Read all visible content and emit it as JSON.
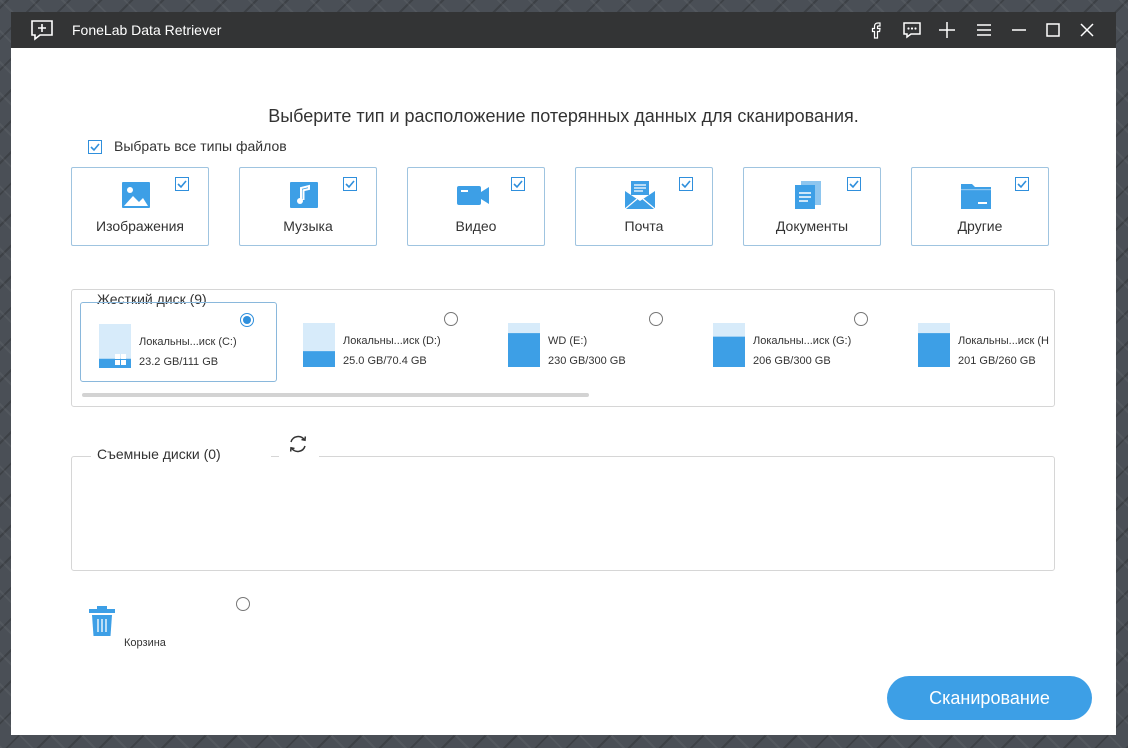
{
  "app": {
    "title": "FoneLab Data Retriever"
  },
  "titlebar": {
    "buttons": [
      "facebook-icon",
      "feedback-icon",
      "plus-icon",
      "menu-icon",
      "minimize-icon",
      "maximize-icon",
      "close-icon"
    ]
  },
  "heading": "Выберите тип и расположение потерянных данных для сканирования.",
  "select_all": {
    "label": "Выбрать все типы файлов",
    "checked": true
  },
  "file_types": [
    {
      "label": "Изображения",
      "icon": "image-icon",
      "checked": true
    },
    {
      "label": "Музыка",
      "icon": "music-icon",
      "checked": true
    },
    {
      "label": "Видео",
      "icon": "video-icon",
      "checked": true
    },
    {
      "label": "Почта",
      "icon": "mail-icon",
      "checked": true
    },
    {
      "label": "Документы",
      "icon": "document-icon",
      "checked": true
    },
    {
      "label": "Другие",
      "icon": "folder-icon",
      "checked": true
    }
  ],
  "hard_disk": {
    "title": "Жесткий диск (9)",
    "drives": [
      {
        "name": "Локальны...иск (C:)",
        "size": "23.2 GB/111 GB",
        "used_fraction": 0.21,
        "selected": true,
        "system": true
      },
      {
        "name": "Локальны...иск (D:)",
        "size": "25.0 GB/70.4 GB",
        "used_fraction": 0.36,
        "selected": false,
        "system": false
      },
      {
        "name": "WD (E:)",
        "size": "230 GB/300 GB",
        "used_fraction": 0.77,
        "selected": false,
        "system": false
      },
      {
        "name": "Локальны...иск (G:)",
        "size": "206 GB/300 GB",
        "used_fraction": 0.69,
        "selected": false,
        "system": false
      },
      {
        "name": "Локальны...иск (H",
        "size": "201 GB/260 GB",
        "used_fraction": 0.77,
        "selected": false,
        "system": false
      }
    ]
  },
  "removable": {
    "title": "Съемные диски (0)"
  },
  "recycle_bin": {
    "label": "Корзина",
    "selected": false
  },
  "scan_button": {
    "label": "Сканирование"
  },
  "colors": {
    "accent": "#3d9fe6",
    "titlebar": "#333435",
    "card_border": "#9fc4e0"
  }
}
